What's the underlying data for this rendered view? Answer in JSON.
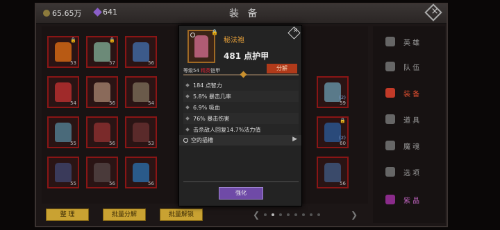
{
  "header": {
    "title": "装 备",
    "gold": "65.65万",
    "gems": "641"
  },
  "grid": {
    "slots": [
      {
        "lvl": "53",
        "color": "#b85a14",
        "lock": true
      },
      {
        "lvl": "57",
        "color": "#6c8a78",
        "lock": true
      },
      {
        "lvl": "56",
        "color": "#3c5a8a",
        "lock": false
      },
      {
        "lvl": "54",
        "color": "#a02a2a",
        "lock": false
      },
      {
        "lvl": "56",
        "color": "#8a6a5a",
        "lock": false
      },
      {
        "lvl": "54",
        "color": "#6a5a4a",
        "lock": false
      },
      {
        "lvl": "59",
        "up": "(2)",
        "color": "#5a7a8a",
        "lock": false
      },
      {
        "lvl": "55",
        "color": "#4a6a7a",
        "lock": false
      },
      {
        "lvl": "56",
        "color": "#7a2a2a",
        "lock": false
      },
      {
        "lvl": "53",
        "color": "#5a2a2a",
        "lock": false
      },
      {
        "lvl": "60",
        "up": "(2)",
        "color": "#2a4a7a",
        "lock": true
      },
      {
        "lvl": "55",
        "color": "#3a3a5a",
        "lock": false
      },
      {
        "lvl": "56",
        "color": "#2a5a8a",
        "lock": false
      },
      {
        "lvl": "56",
        "color": "#3a4a6a",
        "lock": false
      },
      {
        "lvl": "56",
        "color": "#4a3a3a",
        "lock": false
      }
    ]
  },
  "buttons": {
    "sort": "整 理",
    "batch_dismantle": "批量分解",
    "batch_unlock": "批量解锁"
  },
  "nav": {
    "items": [
      {
        "label": "英 雄"
      },
      {
        "label": "队 伍"
      },
      {
        "label": "装 备"
      },
      {
        "label": "道 具"
      },
      {
        "label": "魔 魂"
      },
      {
        "label": "选 项"
      },
      {
        "label": "紫 晶"
      }
    ]
  },
  "tooltip": {
    "name": "秘法袍",
    "armor": "481 点护甲",
    "level_prefix": "等级54",
    "level_tag": "精英",
    "level_type": "铠甲",
    "dismantle": "分解",
    "stats": [
      "184 点智力",
      "5.8% 暴击几率",
      "6.9% 吸血",
      "76% 暴击伤害",
      "击杀敌人回复14.7%法力值"
    ],
    "socket": "空的插槽",
    "enhance": "强化"
  },
  "colors": {
    "accent_gold": "#c9a232",
    "active_nav": "#d94c2e",
    "item_name": "#e8a13a",
    "enhance": "#6f4aa7"
  }
}
